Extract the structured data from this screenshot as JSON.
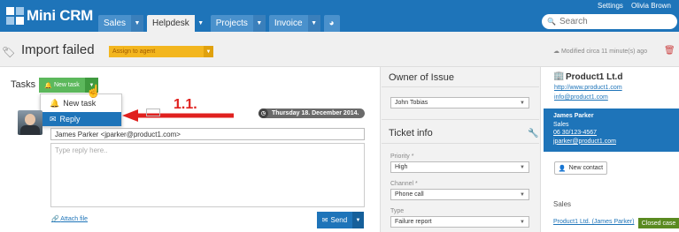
{
  "app": {
    "logo_text": "Mini CRM"
  },
  "nav": {
    "tabs": [
      {
        "label": "Sales"
      },
      {
        "label": "Helpdesk"
      },
      {
        "label": "Projects"
      },
      {
        "label": "Invoice"
      }
    ],
    "settings": "Settings",
    "user": "Olivia Brown",
    "search_placeholder": "Search"
  },
  "page": {
    "title": "Import failed",
    "assign": "Assign to agent",
    "modified": "Modified circa 11 minute(s) ago"
  },
  "tasks": {
    "label": "Tasks",
    "new_task": "New task",
    "menu": [
      {
        "label": "New task"
      },
      {
        "label": "Reply"
      }
    ]
  },
  "annotation": {
    "label": "1.1."
  },
  "reply": {
    "date": "Thursday 18. December 2014.",
    "to": "James Parker <jparker@product1.com>",
    "placeholder": "Type reply here..",
    "attach": "Attach file",
    "send": "Send"
  },
  "owner": {
    "title": "Owner of Issue",
    "value": "John Tobias"
  },
  "ticket": {
    "title": "Ticket info",
    "fields": [
      {
        "label": "Priority *",
        "value": "High"
      },
      {
        "label": "Channel *",
        "value": "Phone call"
      },
      {
        "label": "Type",
        "value": "Failure report"
      }
    ]
  },
  "company": {
    "name": "Product1 Lt.d",
    "website": "http://www.product1.com",
    "email": "info@product1.com",
    "contact": {
      "name": "James Parker",
      "role": "Sales",
      "phone": "06 30/123-4567",
      "email": "jparker@product1.com"
    },
    "new_contact": "New contact"
  },
  "sales": {
    "label": "Sales",
    "link": "Product1 Ltd. (James Parker)",
    "status": "Closed case"
  },
  "colors": {
    "primary": "#1e74b9",
    "accent": "#f3b61f",
    "success": "#5cb85c",
    "annotation": "#e0211f"
  }
}
